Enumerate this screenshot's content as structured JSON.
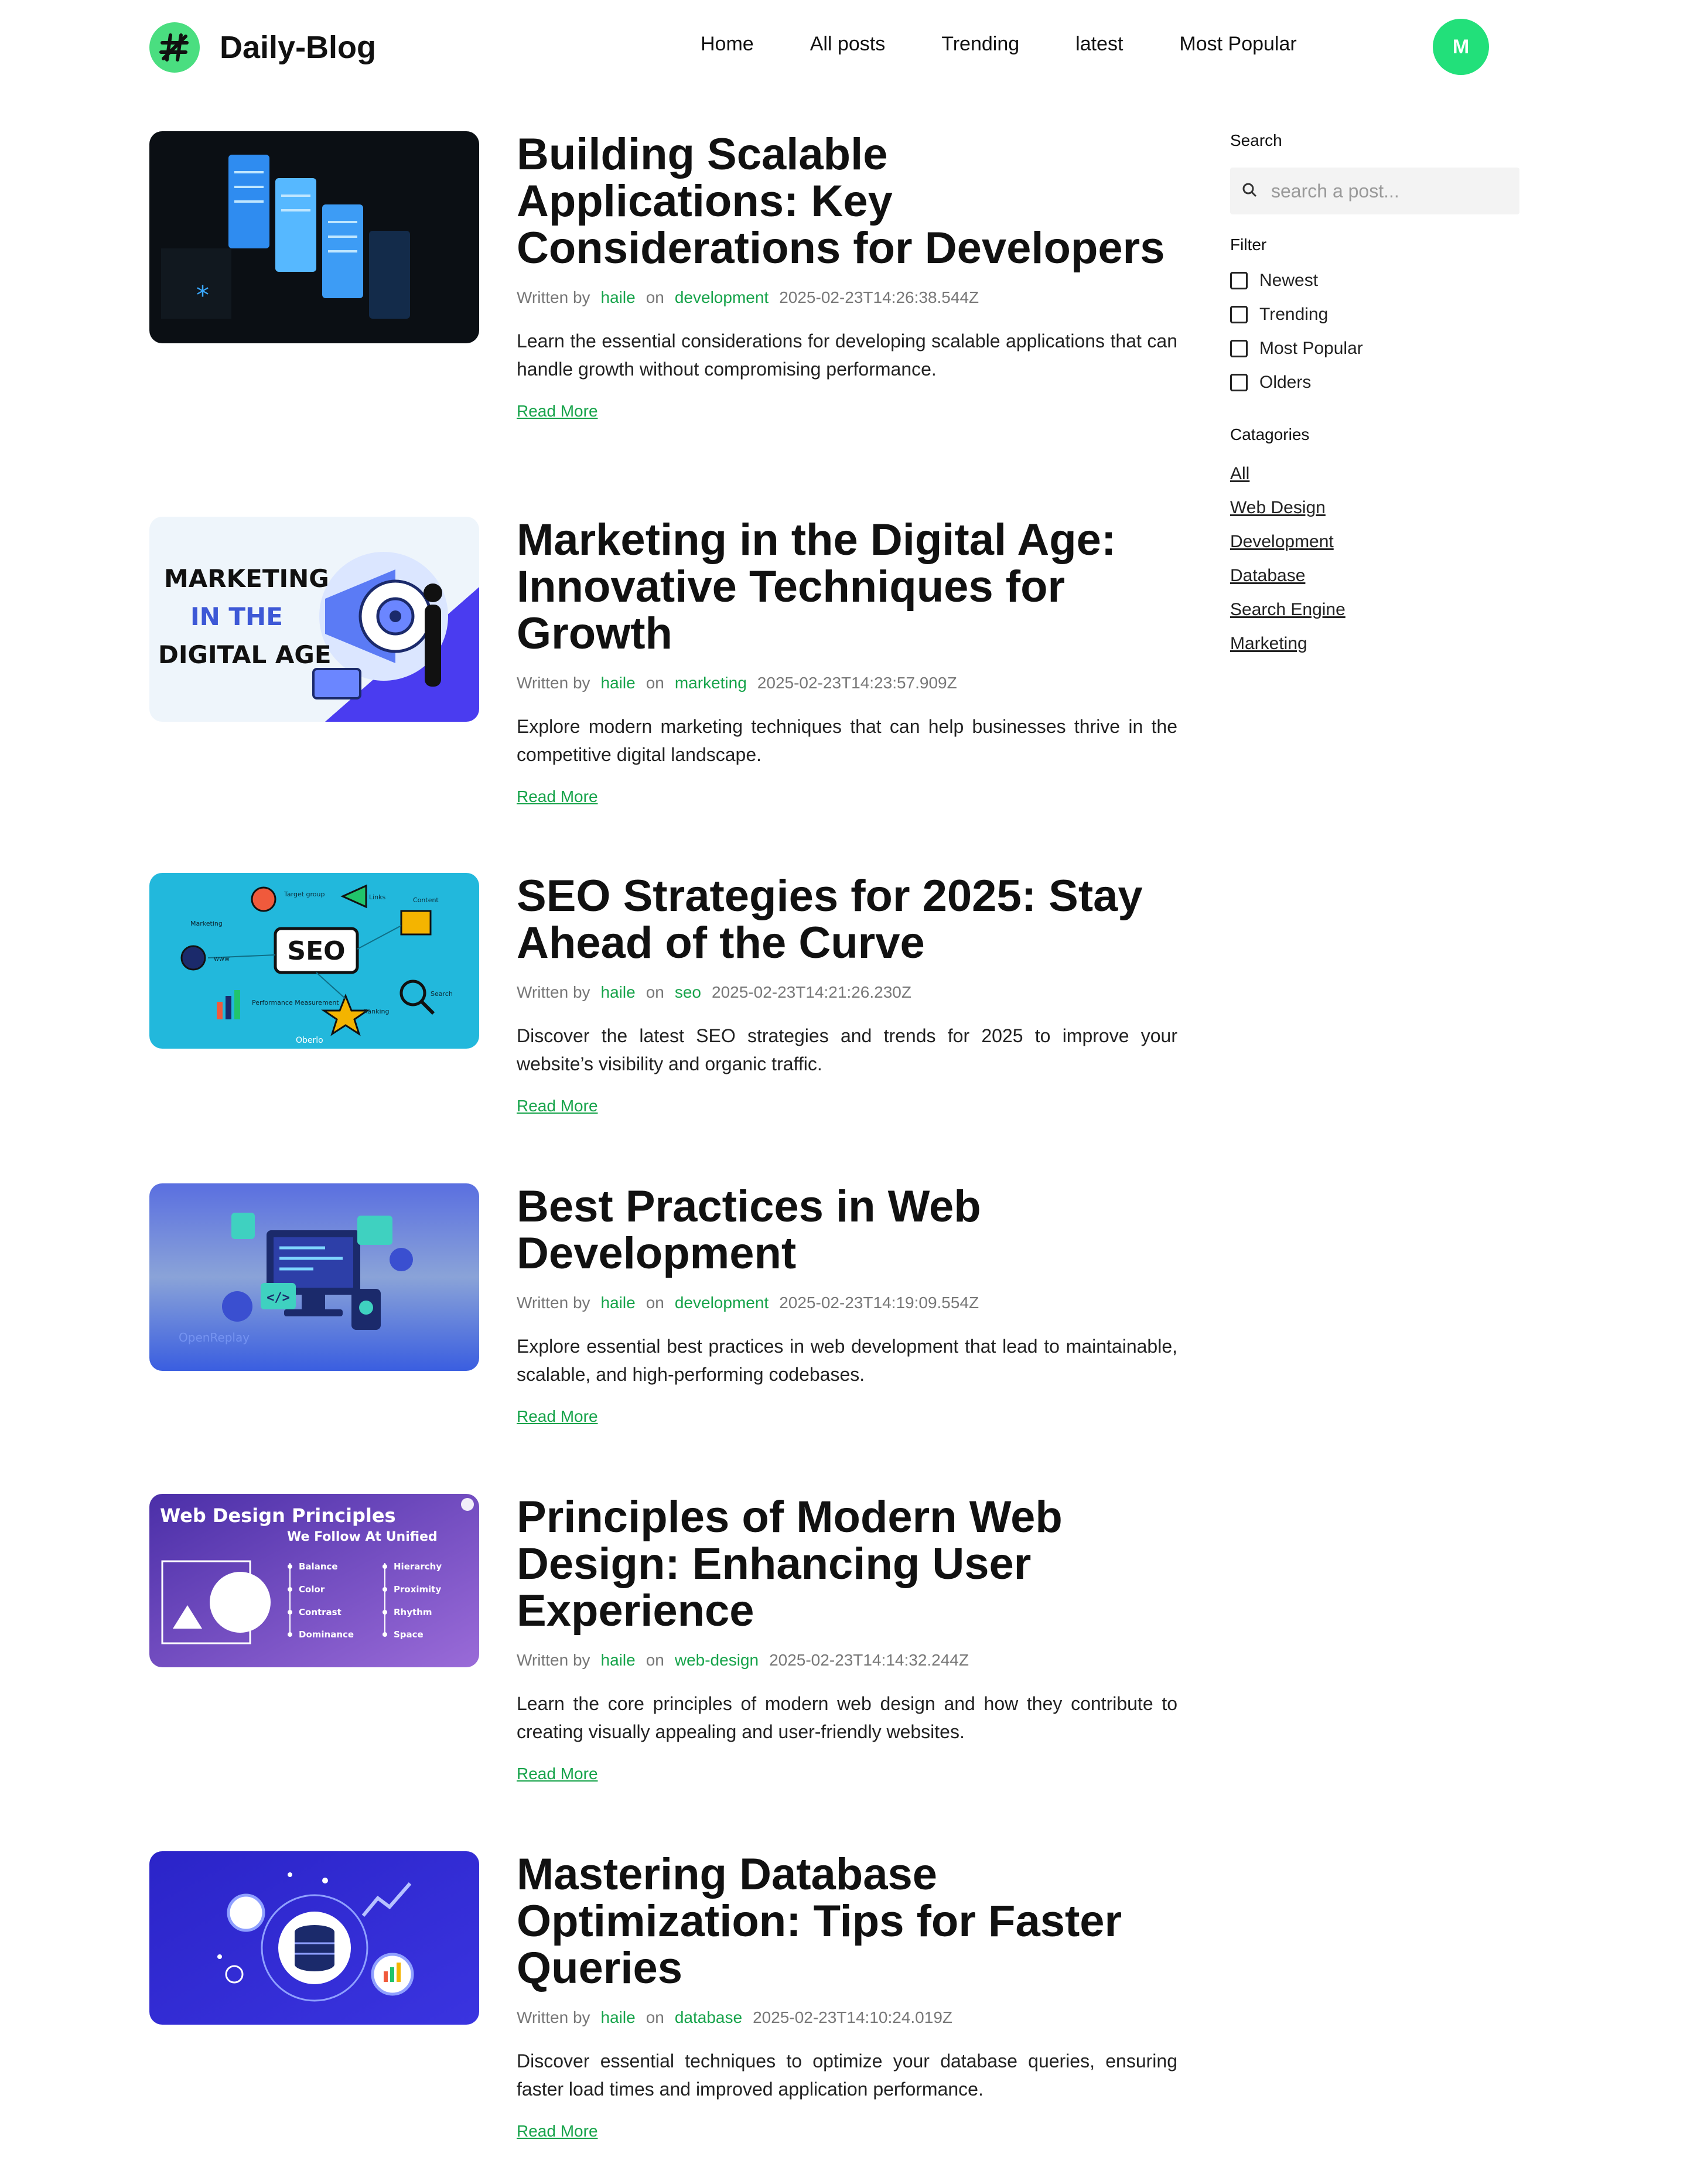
{
  "header": {
    "brand": "Daily-Blog",
    "nav": [
      "Home",
      "All posts",
      "Trending",
      "latest",
      "Most Popular"
    ],
    "avatar_initial": "M"
  },
  "posts": [
    {
      "title": "Building Scalable Applications: Key Considerations for Developers",
      "written_by": "Written by",
      "author": "haile",
      "on": "on",
      "category": "development",
      "date": "2025-02-23T14:26:38.544Z",
      "excerpt": "Learn the essential considerations for developing scalable applications that can handle growth without compromising performance.",
      "read_more": "Read More"
    },
    {
      "title": "Marketing in the Digital Age: Innovative Techniques for Growth",
      "written_by": "Written by",
      "author": "haile",
      "on": "on",
      "category": "marketing",
      "date": "2025-02-23T14:23:57.909Z",
      "excerpt": "Explore modern marketing techniques that can help businesses thrive in the competitive digital landscape.",
      "read_more": "Read More",
      "thumb_text": [
        "MARKETING",
        "IN THE",
        "DIGITAL AGE"
      ]
    },
    {
      "title": "SEO Strategies for 2025: Stay Ahead of the Curve",
      "written_by": "Written by",
      "author": "haile",
      "on": "on",
      "category": "seo",
      "date": "2025-02-23T14:21:26.230Z",
      "excerpt": "Discover the latest SEO strategies and trends for 2025 to improve your website’s visibility and organic traffic.",
      "read_more": "Read More",
      "thumb_text": [
        "SEO",
        "Marketing",
        "Target group",
        "Links",
        "Content",
        "Performance Measurement",
        "Ranking",
        "Search",
        "www",
        "Oberlo"
      ]
    },
    {
      "title": "Best Practices in Web Development",
      "written_by": "Written by",
      "author": "haile",
      "on": "on",
      "category": "development",
      "date": "2025-02-23T14:19:09.554Z",
      "excerpt": "Explore essential best practices in web development that lead to maintainable, scalable, and high-performing codebases.",
      "read_more": "Read More",
      "thumb_text": [
        "</>",
        "OpenReplay"
      ]
    },
    {
      "title": "Principles of Modern Web Design: Enhancing User Experience",
      "written_by": "Written by",
      "author": "haile",
      "on": "on",
      "category": "web-design",
      "date": "2025-02-23T14:14:32.244Z",
      "excerpt": "Learn the core principles of modern web design and how they contribute to creating visually appealing and user-friendly websites.",
      "read_more": "Read More",
      "thumb_text": [
        "Web Design Principles",
        "We Follow At Unified",
        "Balance",
        "Color",
        "Contrast",
        "Dominance",
        "Hierarchy",
        "Proximity",
        "Rhythm",
        "Space"
      ]
    },
    {
      "title": "Mastering Database Optimization: Tips for Faster Queries",
      "written_by": "Written by",
      "author": "haile",
      "on": "on",
      "category": "database",
      "date": "2025-02-23T14:10:24.019Z",
      "excerpt": "Discover essential techniques to optimize your database queries, ensuring faster load times and improved application performance.",
      "read_more": "Read More"
    }
  ],
  "sidebar": {
    "search_label": "Search",
    "search_placeholder": "search a post...",
    "filter_label": "Filter",
    "filters": [
      "Newest",
      "Trending",
      "Most Popular",
      "Olders"
    ],
    "categories_label": "Catagories",
    "categories": [
      "All",
      "Web Design",
      "Development",
      "Database",
      "Search Engine",
      "Marketing"
    ]
  },
  "colors": {
    "accent": "#16a34a",
    "avatar": "#22e07a",
    "logo": "#4ade80"
  }
}
